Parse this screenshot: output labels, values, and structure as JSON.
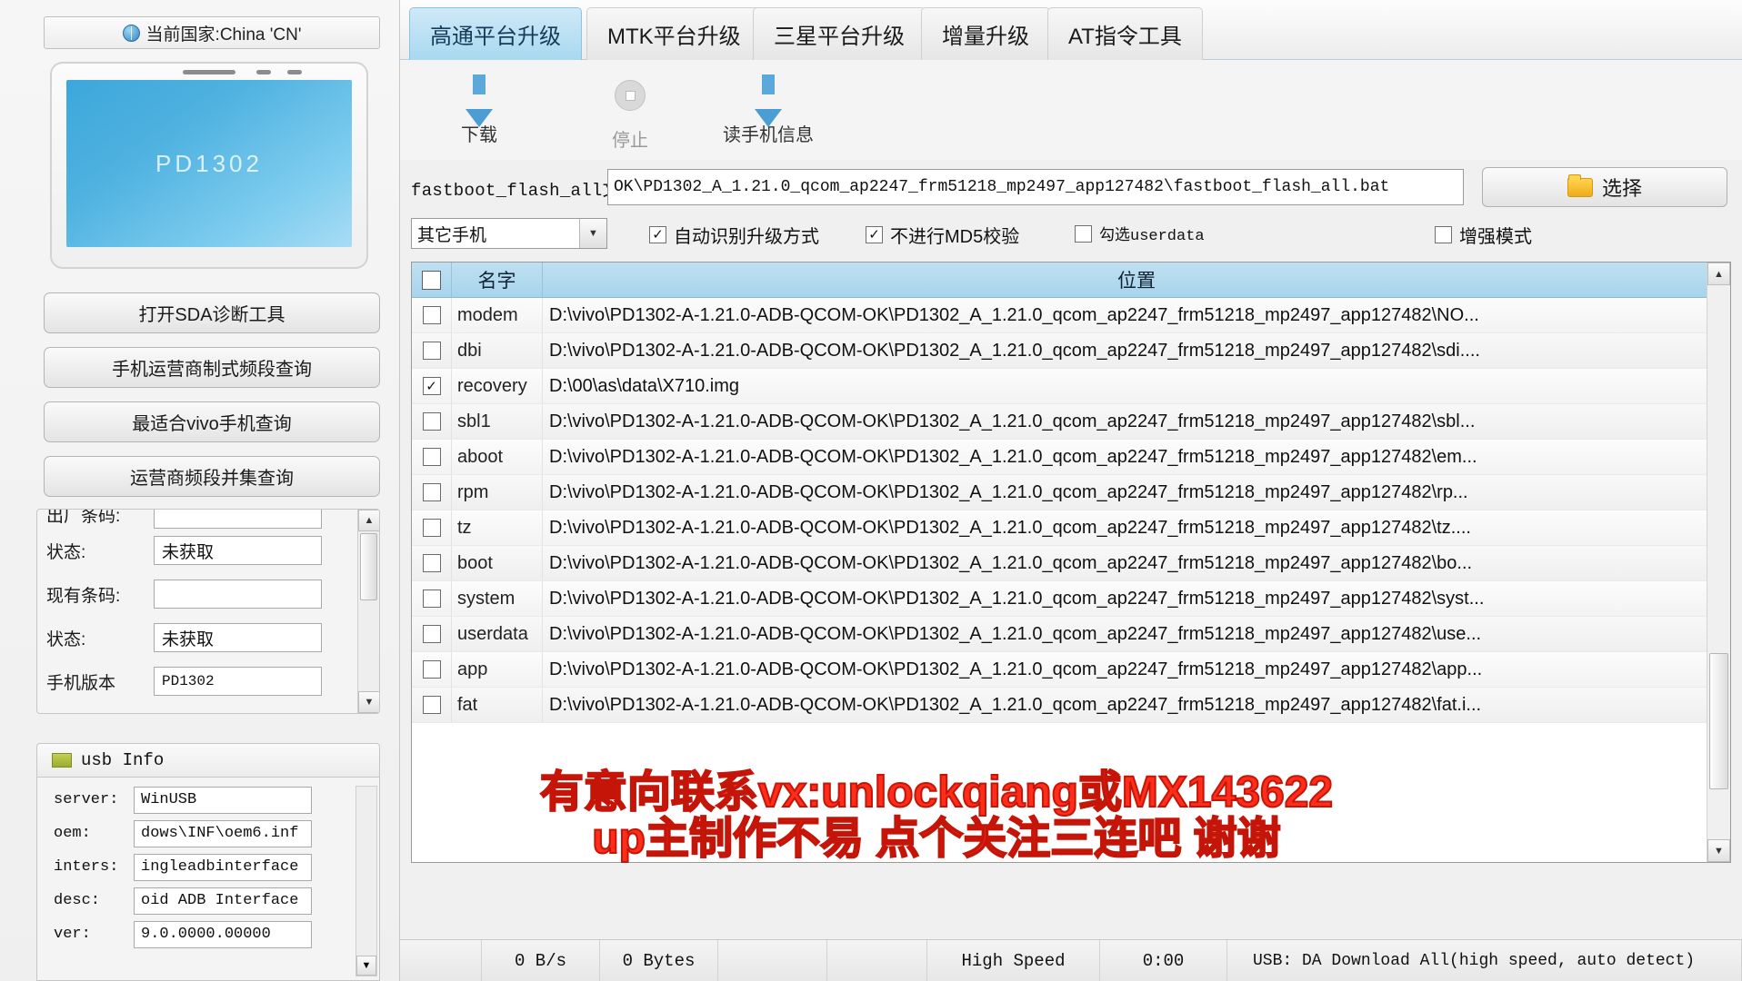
{
  "sidebar": {
    "country_bar": {
      "icon": "globe-icon",
      "text": "当前国家:China 'CN'"
    },
    "phone_preview": {
      "model_text": "PD1302"
    },
    "buttons": [
      {
        "label": "打开SDA诊断工具"
      },
      {
        "label": "手机运营商制式频段查询"
      },
      {
        "label": "最适合vivo手机查询"
      },
      {
        "label": "运营商频段并集查询"
      }
    ],
    "info_rows": [
      {
        "label": "出厂条码:",
        "value": ""
      },
      {
        "label": "状态:",
        "value": "未获取"
      },
      {
        "label": "现有条码:",
        "value": ""
      },
      {
        "label": "状态:",
        "value": "未获取"
      },
      {
        "label": "手机版本",
        "value": "PD1302"
      }
    ],
    "usb_info": {
      "title": "usb Info",
      "rows": [
        {
          "key": "server:",
          "value": "WinUSB"
        },
        {
          "key": "oem:",
          "value": "dows\\INF\\oem6.inf"
        },
        {
          "key": "inters:",
          "value": "ingleadbinterface"
        },
        {
          "key": "desc:",
          "value": "oid ADB Interface"
        },
        {
          "key": "ver:",
          "value": "9.0.0000.00000"
        }
      ]
    }
  },
  "tabs": [
    {
      "label": "高通平台升级",
      "active": true
    },
    {
      "label": "MTK平台升级",
      "active": false
    },
    {
      "label": "三星平台升级",
      "active": false
    },
    {
      "label": "增量升级",
      "active": false
    },
    {
      "label": "AT指令工具",
      "active": false
    }
  ],
  "toolbar": [
    {
      "label": "下载",
      "icon": "download-arrow-icon",
      "enabled": true
    },
    {
      "label": "停止",
      "icon": "stop-circle-icon",
      "enabled": false
    },
    {
      "label": "读手机信息",
      "icon": "download-arrow-icon",
      "enabled": true
    }
  ],
  "path_row": {
    "label": "fastboot_flash_all文件",
    "value": "OK\\PD1302_A_1.21.0_qcom_ap2247_frm51218_mp2497_app127482\\fastboot_flash_all.bat",
    "select_button": {
      "label": "选择",
      "icon": "folder-icon"
    }
  },
  "options": {
    "phone_select": {
      "value": "其它手机"
    },
    "checkboxes": [
      {
        "label": "自动识别升级方式",
        "checked": true
      },
      {
        "label": "不进行MD5校验",
        "checked": true
      },
      {
        "label": "勾选userdata",
        "checked": false
      },
      {
        "label": "增强模式",
        "checked": false
      }
    ]
  },
  "table": {
    "select_all_checked": false,
    "headers": [
      "",
      "名字",
      "位置"
    ],
    "rows": [
      {
        "checked": false,
        "name": "modem",
        "path": "D:\\vivo\\PD1302-A-1.21.0-ADB-QCOM-OK\\PD1302_A_1.21.0_qcom_ap2247_frm51218_mp2497_app127482\\NO..."
      },
      {
        "checked": false,
        "name": "dbi",
        "path": "D:\\vivo\\PD1302-A-1.21.0-ADB-QCOM-OK\\PD1302_A_1.21.0_qcom_ap2247_frm51218_mp2497_app127482\\sdi...."
      },
      {
        "checked": true,
        "name": "recovery",
        "path": "D:\\00\\as\\data\\X710.img"
      },
      {
        "checked": false,
        "name": "sbl1",
        "path": "D:\\vivo\\PD1302-A-1.21.0-ADB-QCOM-OK\\PD1302_A_1.21.0_qcom_ap2247_frm51218_mp2497_app127482\\sbl..."
      },
      {
        "checked": false,
        "name": "aboot",
        "path": "D:\\vivo\\PD1302-A-1.21.0-ADB-QCOM-OK\\PD1302_A_1.21.0_qcom_ap2247_frm51218_mp2497_app127482\\em..."
      },
      {
        "checked": false,
        "name": "rpm",
        "path": "D:\\vivo\\PD1302-A-1.21.0-ADB-QCOM-OK\\PD1302_A_1.21.0_qcom_ap2247_frm51218_mp2497_app127482\\rp..."
      },
      {
        "checked": false,
        "name": "tz",
        "path": "D:\\vivo\\PD1302-A-1.21.0-ADB-QCOM-OK\\PD1302_A_1.21.0_qcom_ap2247_frm51218_mp2497_app127482\\tz...."
      },
      {
        "checked": false,
        "name": "boot",
        "path": "D:\\vivo\\PD1302-A-1.21.0-ADB-QCOM-OK\\PD1302_A_1.21.0_qcom_ap2247_frm51218_mp2497_app127482\\bo..."
      },
      {
        "checked": false,
        "name": "system",
        "path": "D:\\vivo\\PD1302-A-1.21.0-ADB-QCOM-OK\\PD1302_A_1.21.0_qcom_ap2247_frm51218_mp2497_app127482\\syst..."
      },
      {
        "checked": false,
        "name": "userdata",
        "path": "D:\\vivo\\PD1302-A-1.21.0-ADB-QCOM-OK\\PD1302_A_1.21.0_qcom_ap2247_frm51218_mp2497_app127482\\use..."
      },
      {
        "checked": false,
        "name": "app",
        "path": "D:\\vivo\\PD1302-A-1.21.0-ADB-QCOM-OK\\PD1302_A_1.21.0_qcom_ap2247_frm51218_mp2497_app127482\\app..."
      },
      {
        "checked": false,
        "name": "fat",
        "path": "D:\\vivo\\PD1302-A-1.21.0-ADB-QCOM-OK\\PD1302_A_1.21.0_qcom_ap2247_frm51218_mp2497_app127482\\fat.i..."
      }
    ]
  },
  "watermark": {
    "line1": "有意向联系vx:unlockqiang或MX143622",
    "line2": "up主制作不易 点个关注三连吧 谢谢",
    "color": "#ff2d1a"
  },
  "statusbar": {
    "speed": "0 B/s",
    "bytes": "0 Bytes",
    "field3": "",
    "field4": "",
    "mode": "High Speed",
    "elapsed": "0:00",
    "usb": "USB: DA Download All(high speed, auto detect)"
  }
}
